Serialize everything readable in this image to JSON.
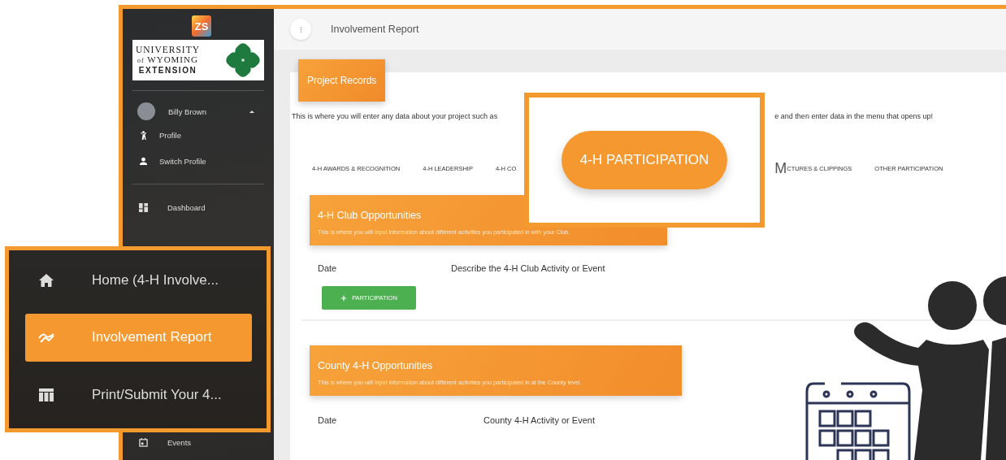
{
  "sidebar": {
    "app_logo": "ZS",
    "institution_logo": {
      "lines": [
        "UNIVERSITY",
        "of",
        "WYOMING",
        "EXTENSION"
      ]
    },
    "user": {
      "name": "Billy Brown",
      "expanded": true
    },
    "user_menu": [
      {
        "label": "Profile",
        "kind": "person"
      },
      {
        "label": "Switch Profile",
        "kind": "account"
      }
    ],
    "items": [
      {
        "label": "Dashboard",
        "kind": "dashboard",
        "selected": false
      }
    ],
    "bottom_items": [
      {
        "label": "Events",
        "kind": "calendar",
        "selected": false
      }
    ]
  },
  "top_bar": {
    "title": "Involvement Report"
  },
  "project_records": {
    "tab_label": "Project Records",
    "description_parts": [
      "This is where you will enter any data about your project such as",
      "e and then enter data in the menu that opens up!"
    ],
    "tabs": [
      {
        "label": "4-H AWARDS & RECOGNITION",
        "selected": false
      },
      {
        "label": "4-H LEADERSHIP",
        "selected": false
      },
      {
        "label": "4-H CO",
        "selected": false
      },
      {
        "label": "M",
        "kind": "fragment",
        "selected": false
      },
      {
        "label": "CTURES & CLIPPINGS",
        "selected": false
      },
      {
        "label": "OTHER PARTICIPATION",
        "selected": false
      }
    ]
  },
  "sections": [
    {
      "title": "4-H Club Opportunities",
      "description": "This is where you will input information about different activities you participated in with your Club.",
      "columns": [
        "Date",
        "Describe the 4-H Club Activity or Event"
      ],
      "add_button": "PARTICIPATION"
    },
    {
      "title": "County 4-H Opportunities",
      "description": "This is where you will input information about different activities you participated in at the County level.",
      "columns": [
        "Date",
        "County 4-H Activity or Event"
      ]
    }
  ],
  "tab_callout": {
    "label": "4-H PARTICIPATION",
    "selected": true
  },
  "menu_callout": {
    "items": [
      {
        "label": "Home (4-H Involve...",
        "kind": "home",
        "selected": false
      },
      {
        "label": "Involvement Report",
        "kind": "trend",
        "selected": true
      },
      {
        "label": "Print/Submit Your 4...",
        "kind": "table",
        "selected": false
      }
    ]
  }
}
